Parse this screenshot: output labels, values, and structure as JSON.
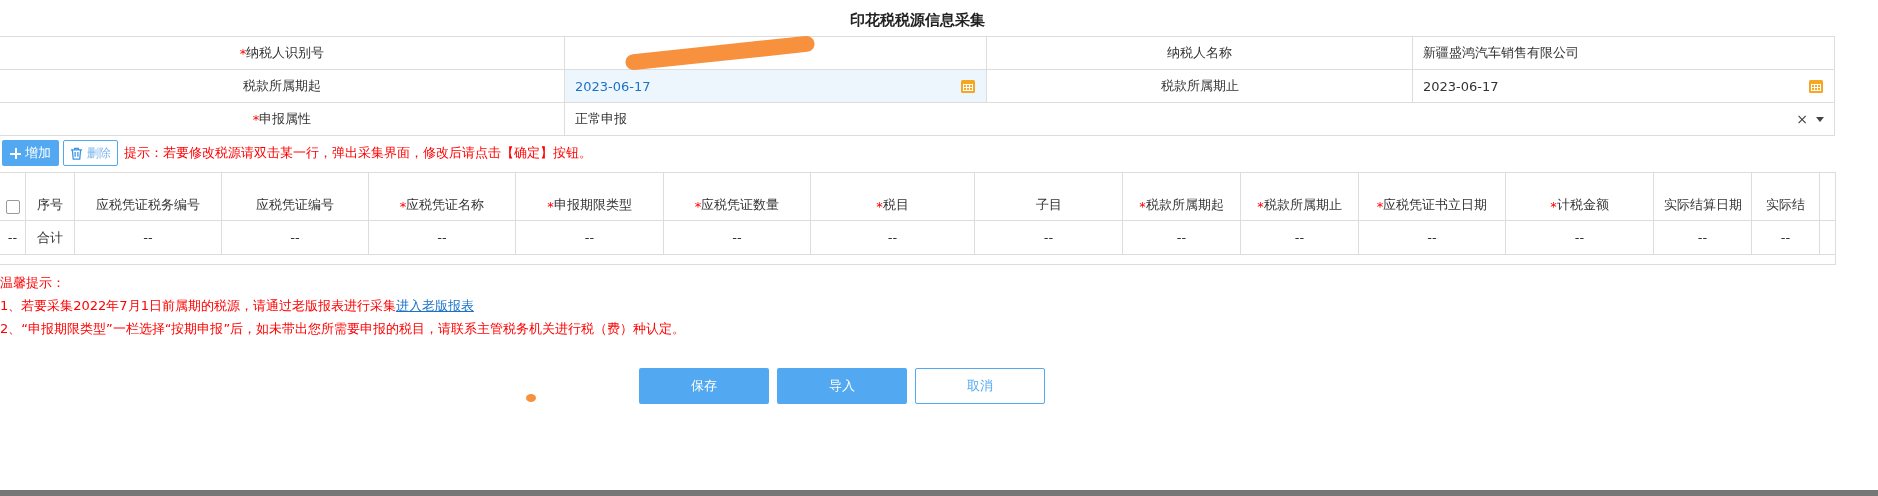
{
  "title": "印花税税源信息采集",
  "form": [
    {
      "label": "纳税人识别号",
      "mark": "*",
      "kind": "redacted"
    },
    {
      "label": "纳税人名称",
      "kind": "text",
      "value": "新疆盛鸿汽车销售有限公司"
    },
    {
      "label": "税款所属期起",
      "kind": "date",
      "value": "2023-06-17",
      "focused": true
    },
    {
      "label": "税款所属期止",
      "kind": "date",
      "value": "2023-06-17",
      "focused": false
    },
    {
      "label": "申报属性",
      "mark": "*",
      "kind": "select",
      "value": "正常申报",
      "clear": "×"
    }
  ],
  "toolbar": {
    "add": "增加",
    "delete": "删除",
    "hint": "提示：若要修改税源请双击某一行，弹出采集界面，修改后请点击【确定】按钮。"
  },
  "table": {
    "columns": [
      {
        "kind": "checkbox",
        "checked": false
      },
      {
        "kind": "text",
        "label": "序号"
      },
      {
        "kind": "text",
        "label": "应税凭证税务编号"
      },
      {
        "kind": "text",
        "label": "应税凭证编号"
      },
      {
        "kind": "text",
        "label": "应税凭证名称",
        "mark": "*"
      },
      {
        "kind": "text",
        "label": "申报期限类型",
        "mark": "*"
      },
      {
        "kind": "text",
        "label": "应税凭证数量",
        "mark": "*"
      },
      {
        "kind": "text",
        "label": "税目",
        "mark": "*"
      },
      {
        "kind": "text",
        "label": "子目"
      },
      {
        "kind": "text",
        "label": "税款所属期起",
        "mark": "*"
      },
      {
        "kind": "text",
        "label": "税款所属期止",
        "mark": "*"
      },
      {
        "kind": "text",
        "label": "应税凭证书立日期",
        "mark": "*"
      },
      {
        "kind": "text",
        "label": "计税金额",
        "mark": "*"
      },
      {
        "kind": "text",
        "label": "实际结算日期"
      },
      {
        "kind": "text",
        "label": "实际结"
      }
    ],
    "rows": [
      [
        "--",
        "合计",
        "--",
        "--",
        "--",
        "--",
        "--",
        "--",
        "--",
        "--",
        "--",
        "--",
        "--",
        "--",
        "--"
      ]
    ]
  },
  "notes": {
    "title": "温馨提示：",
    "items": [
      {
        "text": "1、若要采集2022年7月1日前属期的税源，请通过老版报表进行采集",
        "link": "进入老版报表"
      },
      {
        "text": "2、“申报期限类型”一栏选择“按期申报”后，如未带出您所需要申报的税目，请联系主管税务机关进行税（费）种认定。"
      }
    ]
  },
  "buttons": [
    {
      "label": "保存",
      "kind": "primary"
    },
    {
      "label": "导入",
      "kind": "primary"
    },
    {
      "label": "取消",
      "kind": "outline"
    }
  ]
}
